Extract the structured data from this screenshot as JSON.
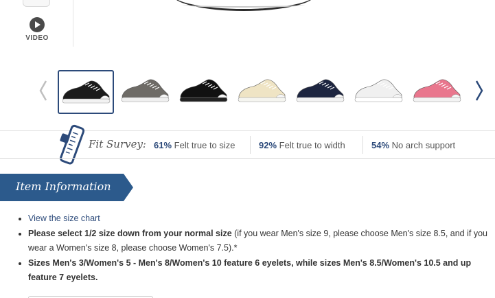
{
  "gallery": {
    "video_label": "VIDEO",
    "thumbnails": [
      {
        "name": "black",
        "upper": "#1b1b1b",
        "sole": "#f2f2f2",
        "selected": true
      },
      {
        "name": "charcoal",
        "upper": "#6e6b66",
        "sole": "#efefef",
        "selected": false
      },
      {
        "name": "all black",
        "upper": "#111111",
        "sole": "#222222",
        "selected": false
      },
      {
        "name": "natural",
        "upper": "#efe4c4",
        "sole": "#f5f5f0",
        "selected": false
      },
      {
        "name": "navy",
        "upper": "#1d2540",
        "sole": "#f2f2f2",
        "selected": false
      },
      {
        "name": "white",
        "upper": "#f0f0f0",
        "sole": "#ffffff",
        "selected": false
      },
      {
        "name": "pink",
        "upper": "#e9768d",
        "sole": "#f3f3f3",
        "selected": false
      }
    ]
  },
  "fit_survey": {
    "title": "Fit Survey:",
    "items": [
      {
        "percent": "61%",
        "text": " Felt true to size"
      },
      {
        "percent": "92%",
        "text": " Felt true to width"
      },
      {
        "percent": "54%",
        "text": " No arch support"
      }
    ]
  },
  "item_info": {
    "title": "Item Information",
    "size_chart_link": "View the size chart",
    "bullet2_bold": "Please select 1/2 size down from your normal size",
    "bullet2_rest": " (if you wear Men's size 9, please choose Men's size 8.5, and if you wear a Women's size 8, please choose Women's 7.5).*",
    "bullet3_bold": "Sizes Men's 3/Women's 5 - Men's 8/Women's 10 feature 6 eyelets, while sizes Men's 8.5/Women's 10.5 and up feature 7 eyelets."
  },
  "colors": {
    "accent": "#2c4a7a",
    "banner": "#2c5a8c"
  }
}
